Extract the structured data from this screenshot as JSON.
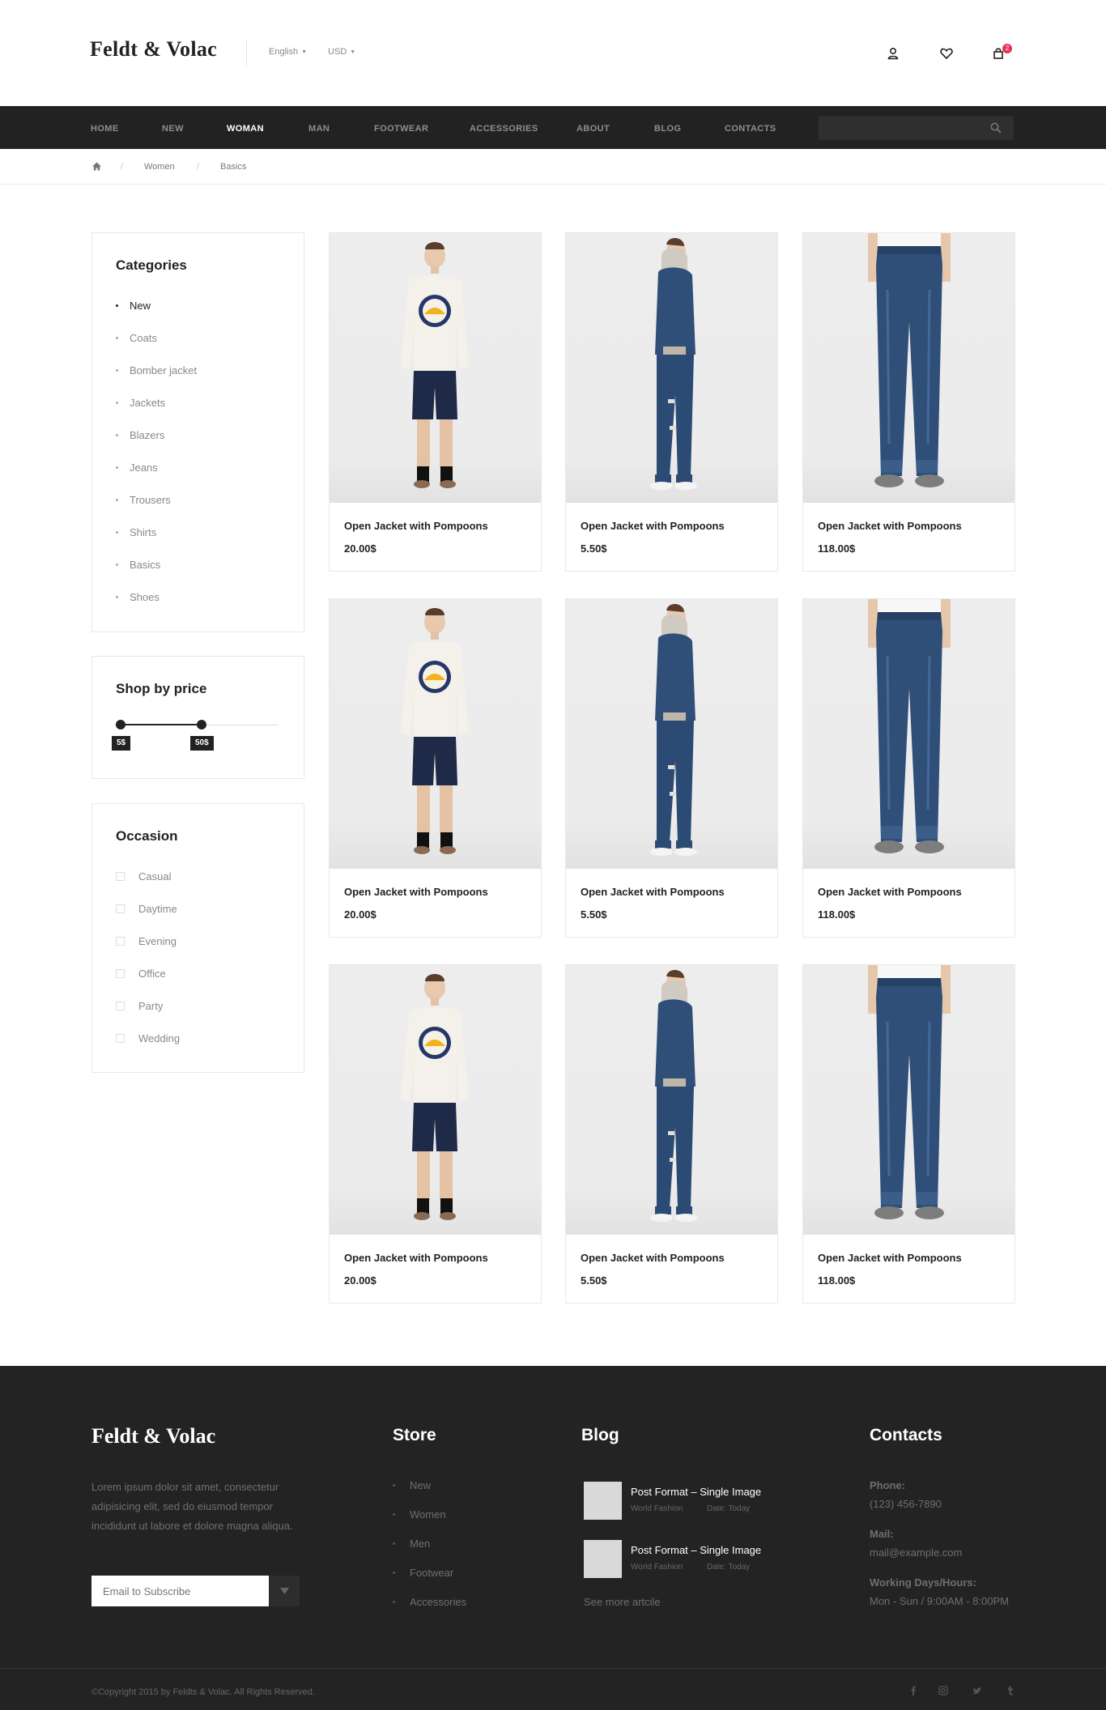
{
  "header": {
    "logo": "Feldt & Volac",
    "language": "English",
    "currency": "USD",
    "cart_count": "2"
  },
  "nav": {
    "items": [
      "HOME",
      "NEW",
      "WOMAN",
      "MAN",
      "FOOTWEAR",
      "ACCESSORIES",
      "ABOUT",
      "BLOG",
      "CONTACTS"
    ],
    "active": "WOMAN",
    "search_value": ""
  },
  "breadcrumb": [
    "Women",
    "Basics"
  ],
  "categories": {
    "title": "Categories",
    "items": [
      "New",
      "Coats",
      "Bomber jacket",
      "Jackets",
      "Blazers",
      "Jeans",
      "Trousers",
      "Shirts",
      "Basics",
      "Shoes"
    ],
    "active": "New"
  },
  "price": {
    "title": "Shop by price",
    "min_label": "5$",
    "max_label": "50$"
  },
  "occasion": {
    "title": "Occasion",
    "items": [
      "Casual",
      "Daytime",
      "Evening",
      "Office",
      "Party",
      "Wedding"
    ]
  },
  "products": [
    {
      "name": "Open Jacket with Pompoons",
      "price": "20.00$",
      "image": "white-sweatshirt-shorts"
    },
    {
      "name": "Open Jacket with Pompoons",
      "price": "5.50$",
      "image": "denim-jacket-side"
    },
    {
      "name": "Open Jacket with Pompoons",
      "price": "118.00$",
      "image": "blue-jeans"
    },
    {
      "name": "Open Jacket with Pompoons",
      "price": "20.00$",
      "image": "white-sweatshirt-shorts"
    },
    {
      "name": "Open Jacket with Pompoons",
      "price": "5.50$",
      "image": "denim-jacket-side"
    },
    {
      "name": "Open Jacket with Pompoons",
      "price": "118.00$",
      "image": "blue-jeans"
    },
    {
      "name": "Open Jacket with Pompoons",
      "price": "20.00$",
      "image": "white-sweatshirt-shorts"
    },
    {
      "name": "Open Jacket with Pompoons",
      "price": "5.50$",
      "image": "denim-jacket-side"
    },
    {
      "name": "Open Jacket with Pompoons",
      "price": "118.00$",
      "image": "blue-jeans"
    }
  ],
  "footer": {
    "logo": "Feldt & Volac",
    "about": "Lorem ipsum dolor sit amet, consectetur adipisicing elit, sed do eiusmod tempor incididunt ut labore et dolore magna aliqua.",
    "subscribe_placeholder": "Email to Subscribe",
    "store_title": "Store",
    "store_links": [
      "New",
      "Women",
      "Men",
      "Footwear",
      "Accessories"
    ],
    "blog_title": "Blog",
    "posts": [
      {
        "title": "Post Format – Single Image",
        "category": "World Fashion",
        "date": "Date: Today"
      },
      {
        "title": "Post Format – Single Image",
        "category": "World Fashion",
        "date": "Date: Today"
      }
    ],
    "see_more": "See more artcile",
    "contacts_title": "Contacts",
    "phone_label": "Phone:",
    "phone": "(123) 456-7890",
    "mail_label": "Mail:",
    "mail": "mail@example.com",
    "hours_label": "Working Days/Hours:",
    "hours": "Mon - Sun / 9:00AM - 8:00PM",
    "copyright": "©Copyright 2015 by Feldts & Volac. All Rights Reserved.",
    "social": [
      "facebook-icon",
      "instagram-icon",
      "twitter-icon",
      "tumblr-icon"
    ]
  },
  "colors": {
    "nav_bg": "#222222",
    "footer_bg": "#232323",
    "badge": "#e8325a",
    "denim": "#2f4f78"
  }
}
